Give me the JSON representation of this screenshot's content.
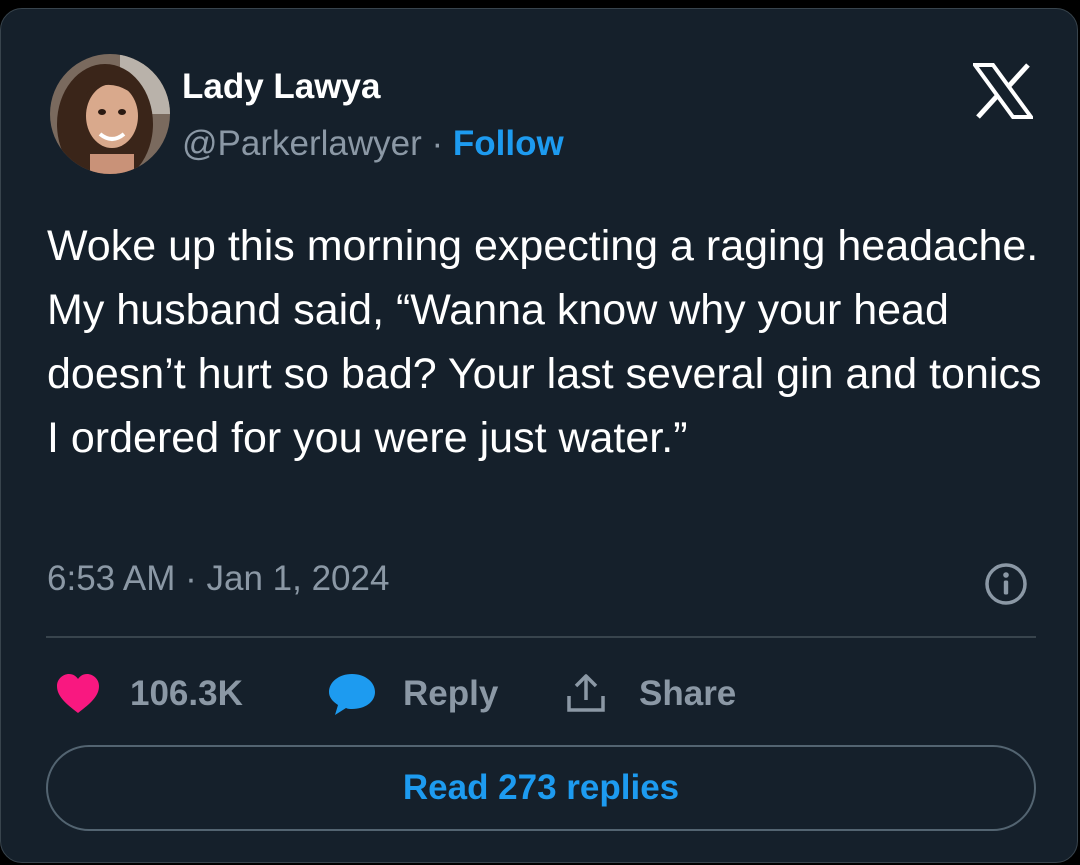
{
  "author": {
    "display_name": "Lady Lawya",
    "handle": "@Parkerlawyer",
    "separator": "·",
    "follow_label": "Follow",
    "avatar_icon": "profile-photo"
  },
  "tweet": {
    "text": "Woke up this morning expecting a raging headache. My husband said, “Wanna know why your head doesn’t hurt so bad? Your last several gin and tonics I ordered for you were just water.”",
    "timestamp": "6:53 AM · Jan 1, 2024"
  },
  "actions": {
    "likes_count": "106.3K",
    "reply_label": "Reply",
    "share_label": "Share",
    "read_replies_label": "Read 273 replies"
  },
  "icons": {
    "logo": "x-logo-icon",
    "info": "info-icon",
    "like": "heart-icon",
    "reply": "speech-bubble-icon",
    "share": "share-upload-icon"
  },
  "colors": {
    "background": "#15202b",
    "accent": "#1d9bf0",
    "like": "#f91880",
    "muted_text": "#8b98a5",
    "text": "#ffffff"
  }
}
